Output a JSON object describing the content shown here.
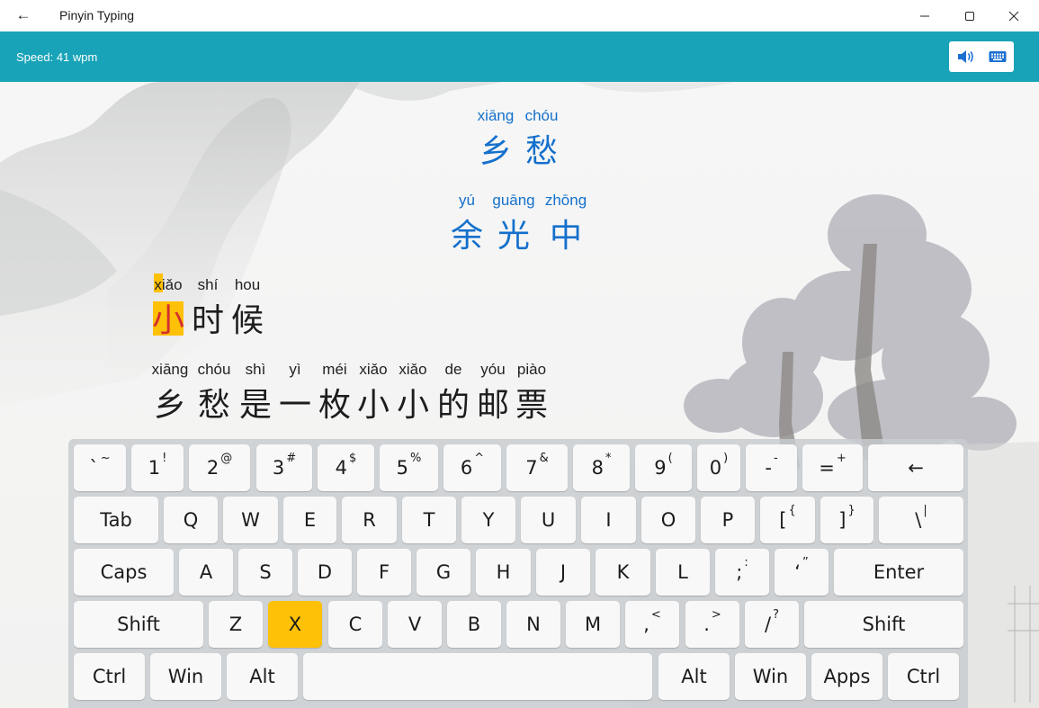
{
  "window": {
    "title": "Pinyin Typing",
    "back_icon": "arrow-left-icon",
    "controls": [
      "minimize-icon",
      "maximize-icon",
      "close-icon"
    ]
  },
  "appbar": {
    "speed": "Speed: 41 wpm",
    "tools": [
      "speaker-icon",
      "keyboard-icon"
    ],
    "color": "#18a3b8"
  },
  "poem": {
    "lines": [
      {
        "state": "done",
        "syllables": [
          {
            "pinyin": "xiāng",
            "hanzi": "乡"
          },
          {
            "pinyin": "chóu",
            "hanzi": "愁"
          }
        ]
      },
      {
        "state": "done",
        "syllables": [
          {
            "pinyin": "yú",
            "hanzi": "余"
          },
          {
            "pinyin": "guāng",
            "hanzi": "光"
          },
          {
            "pinyin": "zhōng",
            "hanzi": "中"
          }
        ]
      },
      {
        "state": "current",
        "syllables": [
          {
            "pinyin": "xiǎo",
            "hanzi": "小"
          },
          {
            "pinyin": "shí",
            "hanzi": "时"
          },
          {
            "pinyin": "hou",
            "hanzi": "候"
          }
        ]
      },
      {
        "state": "pending",
        "syllables": [
          {
            "pinyin": "xiāng",
            "hanzi": "乡"
          },
          {
            "pinyin": "chóu",
            "hanzi": "愁"
          },
          {
            "pinyin": "shì",
            "hanzi": "是"
          },
          {
            "pinyin": "yì",
            "hanzi": "一"
          },
          {
            "pinyin": "méi",
            "hanzi": "枚"
          },
          {
            "pinyin": "xiǎo",
            "hanzi": "小"
          },
          {
            "pinyin": "xiǎo",
            "hanzi": "小"
          },
          {
            "pinyin": "de",
            "hanzi": "的"
          },
          {
            "pinyin": "yóu",
            "hanzi": "邮"
          },
          {
            "pinyin": "piào",
            "hanzi": "票"
          }
        ]
      }
    ],
    "current_char_index": 0,
    "current_letter_index": 0,
    "highlight_color": "#ffc107",
    "done_color": "#1470cc"
  },
  "keyboard": {
    "active_key": "X",
    "rows": [
      [
        {
          "m": "`",
          "s": "~"
        },
        {
          "m": "1",
          "s": "!"
        },
        {
          "m": "2",
          "s": "@"
        },
        {
          "m": "3",
          "s": "#"
        },
        {
          "m": "4",
          "s": "$"
        },
        {
          "m": "5",
          "s": "%"
        },
        {
          "m": "6",
          "s": "^"
        },
        {
          "m": "7",
          "s": "&"
        },
        {
          "m": "8",
          "s": "*"
        },
        {
          "m": "9",
          "s": "("
        },
        {
          "m": "0",
          "s": ")"
        },
        {
          "m": "-",
          "s": "-"
        },
        {
          "m": "=",
          "s": "+"
        },
        {
          "m": "←",
          "s": ""
        }
      ],
      [
        {
          "m": "Tab",
          "s": ""
        },
        {
          "m": "Q",
          "s": ""
        },
        {
          "m": "W",
          "s": ""
        },
        {
          "m": "E",
          "s": ""
        },
        {
          "m": "R",
          "s": ""
        },
        {
          "m": "T",
          "s": ""
        },
        {
          "m": "Y",
          "s": ""
        },
        {
          "m": "U",
          "s": ""
        },
        {
          "m": "I",
          "s": ""
        },
        {
          "m": "O",
          "s": ""
        },
        {
          "m": "P",
          "s": ""
        },
        {
          "m": "[",
          "s": "{"
        },
        {
          "m": "]",
          "s": "}"
        },
        {
          "m": "\\",
          "s": "|"
        }
      ],
      [
        {
          "m": "Caps",
          "s": ""
        },
        {
          "m": "A",
          "s": ""
        },
        {
          "m": "S",
          "s": ""
        },
        {
          "m": "D",
          "s": ""
        },
        {
          "m": "F",
          "s": ""
        },
        {
          "m": "G",
          "s": ""
        },
        {
          "m": "H",
          "s": ""
        },
        {
          "m": "J",
          "s": ""
        },
        {
          "m": "K",
          "s": ""
        },
        {
          "m": "L",
          "s": ""
        },
        {
          "m": ";",
          "s": ":"
        },
        {
          "m": "‘",
          "s": "”"
        },
        {
          "m": "Enter",
          "s": ""
        }
      ],
      [
        {
          "m": "Shift",
          "s": ""
        },
        {
          "m": "Z",
          "s": ""
        },
        {
          "m": "X",
          "s": ""
        },
        {
          "m": "C",
          "s": ""
        },
        {
          "m": "V",
          "s": ""
        },
        {
          "m": "B",
          "s": ""
        },
        {
          "m": "N",
          "s": ""
        },
        {
          "m": "M",
          "s": ""
        },
        {
          "m": ",",
          "s": "<"
        },
        {
          "m": ".",
          "s": ">"
        },
        {
          "m": "/",
          "s": "?"
        },
        {
          "m": "Shift",
          "s": ""
        }
      ],
      [
        {
          "m": "Ctrl",
          "s": ""
        },
        {
          "m": "Win",
          "s": ""
        },
        {
          "m": "Alt",
          "s": ""
        },
        {
          "m": "",
          "s": ""
        },
        {
          "m": "Alt",
          "s": ""
        },
        {
          "m": "Win",
          "s": ""
        },
        {
          "m": "Apps",
          "s": ""
        },
        {
          "m": "Ctrl",
          "s": ""
        }
      ]
    ]
  }
}
